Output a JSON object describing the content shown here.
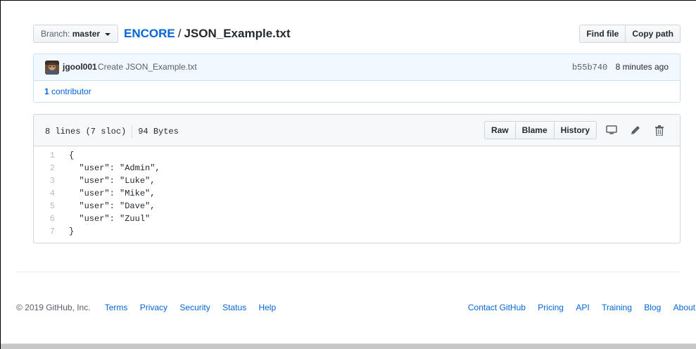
{
  "header": {
    "branch_prefix": "Branch:",
    "branch_name": "master",
    "repo_name": "ENCORE",
    "path_separator": "/",
    "file_name": "JSON_Example.txt",
    "find_file_label": "Find file",
    "copy_path_label": "Copy path"
  },
  "commit": {
    "author": "jgool001",
    "message": "Create JSON_Example.txt",
    "sha": "b55b740",
    "time": "8 minutes ago",
    "contributors_count": "1",
    "contributors_label": "contributor"
  },
  "file": {
    "lines_info": "8 lines (7 sloc)",
    "size": "94 Bytes",
    "raw_label": "Raw",
    "blame_label": "Blame",
    "history_label": "History",
    "icons": [
      "desktop-icon",
      "pencil-icon",
      "trash-icon"
    ],
    "code_lines": [
      {
        "num": "1",
        "text": "{"
      },
      {
        "num": "2",
        "text": "  \"user\": \"Admin\","
      },
      {
        "num": "3",
        "text": "  \"user\": \"Luke\","
      },
      {
        "num": "4",
        "text": "  \"user\": \"Mike\","
      },
      {
        "num": "5",
        "text": "  \"user\": \"Dave\","
      },
      {
        "num": "6",
        "text": "  \"user\": \"Zuul\""
      },
      {
        "num": "7",
        "text": "}"
      }
    ]
  },
  "footer": {
    "copyright": "© 2019 GitHub, Inc.",
    "left_links": [
      "Terms",
      "Privacy",
      "Security",
      "Status",
      "Help"
    ],
    "right_links": [
      "Contact GitHub",
      "Pricing",
      "API",
      "Training",
      "Blog",
      "About"
    ]
  },
  "colors": {
    "link": "#0366d6",
    "commit_bg": "#f1f8ff",
    "commit_border": "#c8e1ff",
    "file_header_bg": "#f6f8fa",
    "line_number": "#babbbc"
  }
}
